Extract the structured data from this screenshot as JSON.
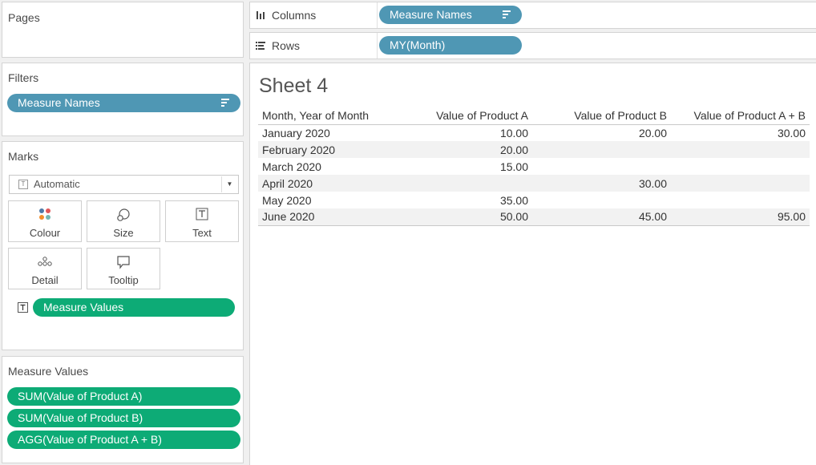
{
  "pages": {
    "title": "Pages"
  },
  "filters": {
    "title": "Filters",
    "pills": [
      {
        "label": "Measure Names",
        "icon": "sort-icon"
      }
    ]
  },
  "marks": {
    "title": "Marks",
    "type": "Automatic",
    "buttons": [
      {
        "label": "Colour",
        "icon": "colour-icon"
      },
      {
        "label": "Size",
        "icon": "size-icon"
      },
      {
        "label": "Text",
        "icon": "text-icon"
      },
      {
        "label": "Detail",
        "icon": "detail-icon"
      },
      {
        "label": "Tooltip",
        "icon": "tooltip-icon"
      }
    ],
    "card_pill": {
      "label": "Measure Values",
      "icon": "text-icon"
    }
  },
  "measure_values": {
    "title": "Measure Values",
    "pills": [
      {
        "label": "SUM(Value of Product A)"
      },
      {
        "label": "SUM(Value of Product B)"
      },
      {
        "label": "AGG(Value of Product A + B)"
      }
    ]
  },
  "shelves": {
    "columns": {
      "label": "Columns",
      "icon": "columns-icon",
      "pill": "Measure Names"
    },
    "rows": {
      "label": "Rows",
      "icon": "rows-icon",
      "pill": "MY(Month)"
    }
  },
  "sheet": {
    "title": "Sheet 4",
    "headers": [
      "Month, Year of Month",
      "Value of Product A",
      "Value of Product B",
      "Value of Product A + B"
    ],
    "rows": [
      {
        "month": "January 2020",
        "a": "10.00",
        "b": "20.00",
        "ab": "30.00"
      },
      {
        "month": "February 2020",
        "a": "20.00",
        "b": "",
        "ab": ""
      },
      {
        "month": "March 2020",
        "a": "15.00",
        "b": "",
        "ab": ""
      },
      {
        "month": "April 2020",
        "a": "",
        "b": "30.00",
        "ab": ""
      },
      {
        "month": "May 2020",
        "a": "35.00",
        "b": "",
        "ab": ""
      },
      {
        "month": "June 2020",
        "a": "50.00",
        "b": "45.00",
        "ab": "95.00"
      }
    ]
  },
  "colors": {
    "dimension_pill": "#4f97b4",
    "measure_pill": "#0dab76"
  }
}
